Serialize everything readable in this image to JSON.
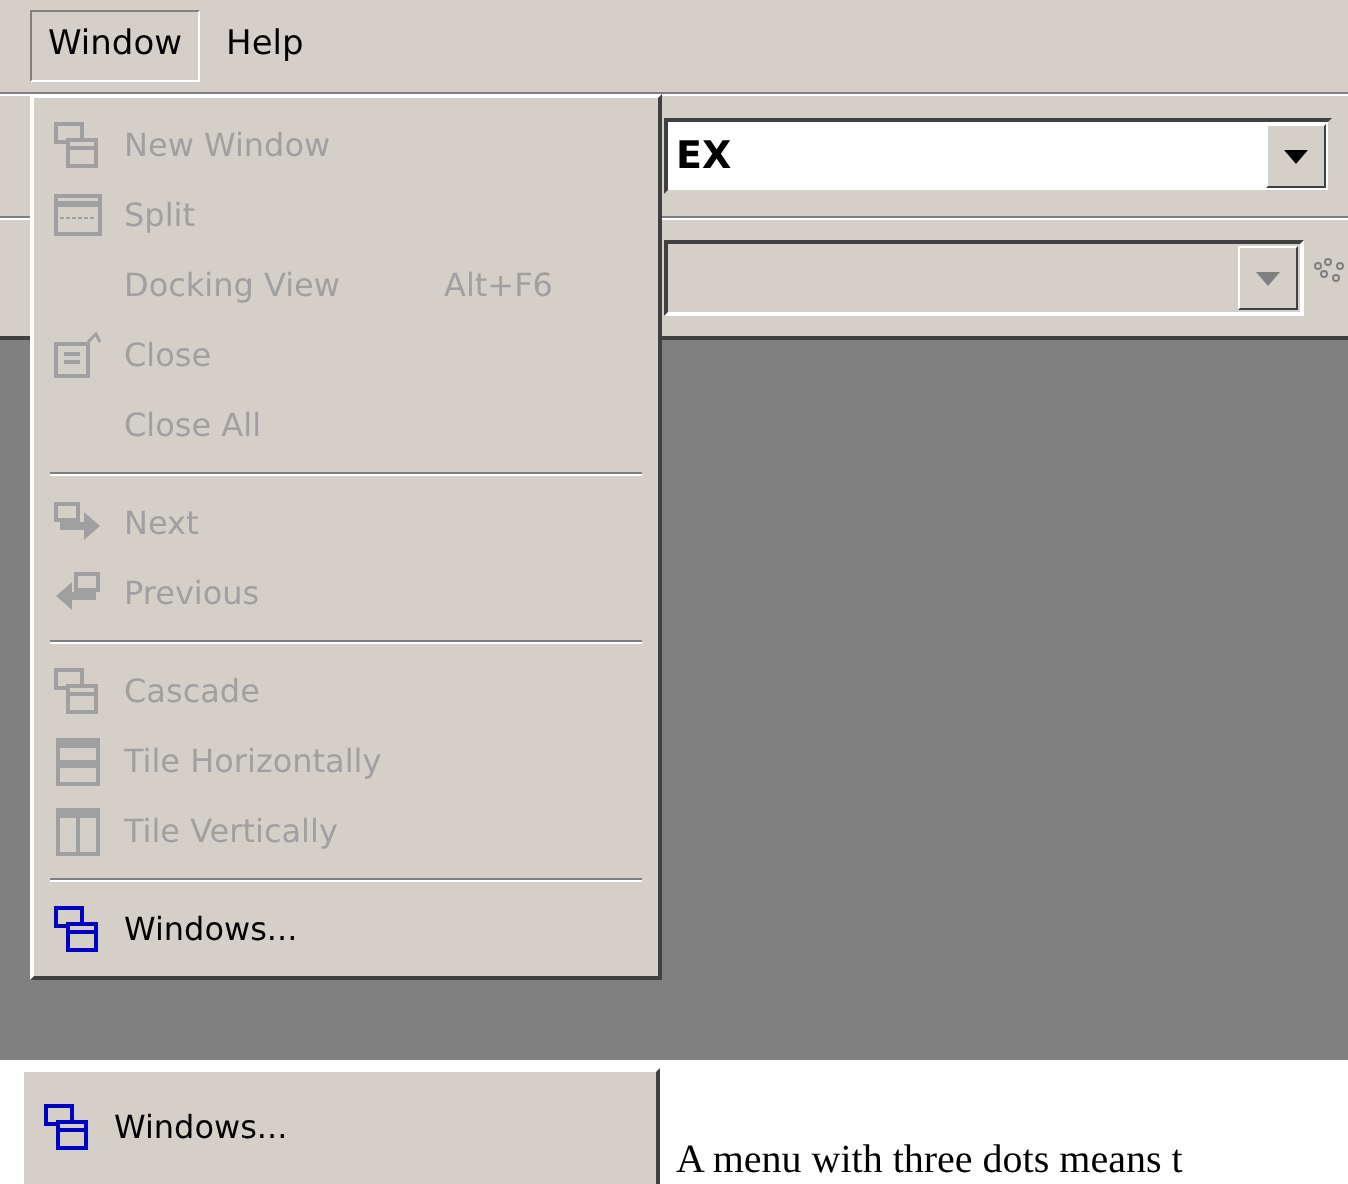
{
  "menubar": [
    {
      "label": "Window",
      "selected": true
    },
    {
      "label": "Help",
      "selected": false
    }
  ],
  "toolbar": {
    "combo_value": "EX",
    "second_combo_disabled": true
  },
  "menu": [
    {
      "kind": "item",
      "label": "New Window",
      "disabled": true
    },
    {
      "kind": "item",
      "label": "Split",
      "disabled": true
    },
    {
      "kind": "item",
      "label": "Docking View",
      "shortcut": "Alt+F6",
      "disabled": true
    },
    {
      "kind": "item",
      "label": "Close",
      "disabled": true
    },
    {
      "kind": "item",
      "label": "Close All",
      "disabled": true
    },
    {
      "kind": "separator"
    },
    {
      "kind": "item",
      "label": "Next",
      "disabled": true
    },
    {
      "kind": "item",
      "label": "Previous",
      "disabled": true
    },
    {
      "kind": "separator"
    },
    {
      "kind": "item",
      "label": "Cascade",
      "disabled": true
    },
    {
      "kind": "item",
      "label": "Tile Horizontally",
      "disabled": true
    },
    {
      "kind": "item",
      "label": "Tile Vertically",
      "disabled": true
    },
    {
      "kind": "separator"
    },
    {
      "kind": "item",
      "label": "Windows...",
      "disabled": false
    }
  ],
  "example_item": {
    "label": "Windows..."
  },
  "caption": "A menu with three dots means t"
}
